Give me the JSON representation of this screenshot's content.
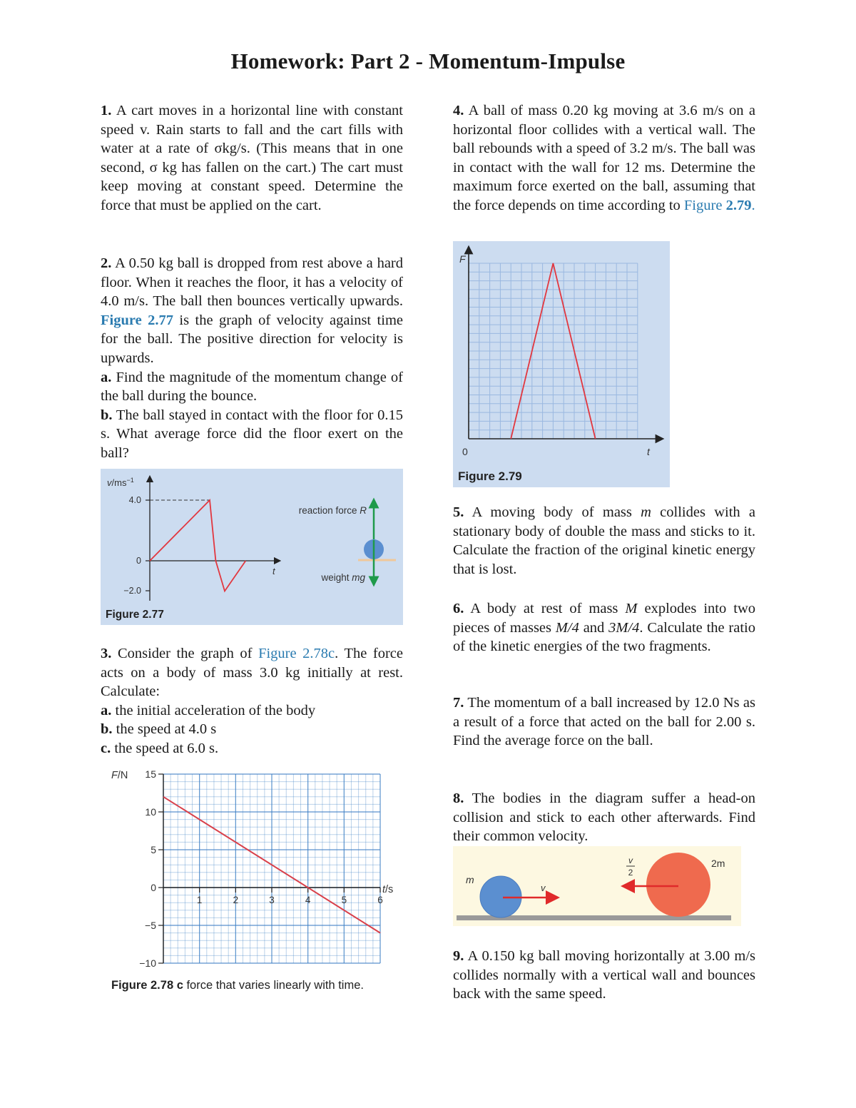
{
  "page": {
    "title": "Homework:  Part 2 - Momentum-Impulse"
  },
  "questions": {
    "q1": {
      "number": "1.",
      "text": "A cart moves in a horizontal line with constant speed v. Rain starts to fall and the cart fills with water at a rate of σkg/s. (This means that in one second, σ kg has fallen on the cart.) The cart must keep moving at constant speed. Determine the force that must be applied on the cart."
    },
    "q2": {
      "number": "2.",
      "text_before_link": "A 0.50 kg ball is dropped from rest above a hard floor. When it reaches the floor, it has a velocity of 4.0 m/s.  The ball then bounces vertically upwards. ",
      "link": "Figure 2.77",
      "text_after_link": " is the graph of velocity against time for the ball. The positive direction for velocity is upwards.",
      "part_a_label": "a.",
      "part_a": "Find the magnitude of the momentum change of the ball during the bounce.",
      "part_b_label": "b.",
      "part_b": "The ball stayed in contact with the floor for 0.15 s. What average force did the floor exert on the ball?"
    },
    "q3": {
      "number": "3.",
      "text_before_link": "Consider the graph of ",
      "link": "Figure 2.78c",
      "text_after_link": ". The force acts on a body of mass 3.0 kg initially at rest. Calculate:",
      "part_a_label": "a.",
      "part_a": "the initial acceleration of the body",
      "part_b_label": "b.",
      "part_b": "the speed at 4.0 s",
      "part_c_label": "c.",
      "part_c": "the speed at 6.0 s."
    },
    "q4": {
      "number": "4.",
      "text_before_link": "A ball of mass 0.20 kg moving at 3.6 m/s on a horizontal floor collides with a vertical wall. The ball rebounds with a speed of 3.2 m/s. The ball was in contact with the wall for 12 ms. Determine the maximum force exerted on the ball, assuming that the force depends on time according to ",
      "link_plain": "Figure ",
      "link_bold": "2.79",
      "text_after_link": "."
    },
    "q5": {
      "number": "5.",
      "text_1": "A moving body of mass ",
      "var_m": "m",
      "text_2": " collides with a stationary body of double the mass and sticks to it. Calculate the fraction of the original kinetic energy that is lost."
    },
    "q6": {
      "number": "6.",
      "text_1": "A body at rest of mass ",
      "var_M": "M",
      "text_2": " explodes into two pieces of masses ",
      "mass1": "M/4",
      "text_3": " and ",
      "mass2": "3M/4",
      "text_4": ". Calculate the ratio of the kinetic energies of the two fragments."
    },
    "q7": {
      "number": "7.",
      "text": "The momentum of a ball increased by 12.0 Ns as a result of a force that acted on the ball for 2.00 s.  Find the average force on the ball."
    },
    "q8": {
      "number": "8.",
      "text": "The bodies in the diagram suffer a head-on collision and stick to each other afterwards. Find their common velocity."
    },
    "q9": {
      "number": "9.",
      "text": "A 0.150 kg ball moving horizontally at 3.00 m/s collides normally with a vertical wall and bounces back with the same speed."
    }
  },
  "figures": {
    "fig277": {
      "caption": "Figure 2.77",
      "reaction_label": "reaction force ",
      "reaction_var": "R",
      "weight_label": "weight ",
      "weight_var": "mg",
      "background": "#ccdcf0",
      "line_color": "#e2373f",
      "arrow_color": "#1e9a4a",
      "ball_color": "#5b8fd0",
      "floor_color": "#f0c89a"
    },
    "fig279": {
      "caption": "Figure 2.79",
      "background": "#ccdcf0",
      "line_color": "#e2373f"
    },
    "fig278c": {
      "caption_bold": "Figure 2.78 ",
      "caption_letter": "c",
      "caption_text": " force that varies linearly with time.",
      "line_color": "#d9404a",
      "grid_color": "#3d7fc4"
    },
    "fig_collision": {
      "small_label": "m",
      "small_velocity": "v",
      "large_label": "2m",
      "large_velocity_num": "v",
      "large_velocity_den": "2",
      "background": "#fdf8e1",
      "small_color": "#5b8fd0",
      "large_color": "#ef6a4e",
      "arrow_color": "#e02a2a",
      "floor_color": "#9a9a9a"
    }
  },
  "chart_data": [
    {
      "id": "fig277",
      "type": "line",
      "title": "Figure 2.77",
      "xlabel": "t",
      "ylabel": "v/ms⁻¹",
      "ytick_labels": [
        "4.0",
        "0",
        "−2.0"
      ],
      "yticks": [
        4.0,
        0,
        -2.0
      ],
      "ylim": [
        -2.5,
        5
      ],
      "x_units": "arbitrary time units (not labelled)",
      "x": [
        0,
        1.0,
        1.1,
        1.25,
        1.6
      ],
      "y": [
        0,
        4.0,
        0,
        -2.0,
        0
      ],
      "reference_lines": [
        {
          "type": "dashed-horizontal",
          "y": 4.0
        }
      ],
      "grid": false
    },
    {
      "id": "fig279",
      "type": "line",
      "title": "Figure 2.79",
      "xlabel": "t",
      "ylabel": "F",
      "origin_label": "0",
      "grid_cells_x": 16,
      "grid_cells_y": 20,
      "x": [
        0,
        4,
        8,
        12,
        16
      ],
      "y": [
        0,
        0,
        20,
        0,
        0
      ],
      "x_units": "grid cells (unlabelled)",
      "y_units": "grid cells (unlabelled)",
      "grid": true
    },
    {
      "id": "fig278c",
      "type": "line",
      "title": "Figure 2.78 c force that varies linearly with time.",
      "xlabel": "t/s",
      "ylabel": "F/N",
      "xticks": [
        1,
        2,
        3,
        4,
        5,
        6
      ],
      "xtick_labels": [
        "1",
        "2",
        "3",
        "4",
        "5",
        "6"
      ],
      "yticks": [
        15,
        10,
        5,
        0,
        -5,
        -10
      ],
      "ytick_labels": [
        "15",
        "10",
        "5",
        "0",
        "−5",
        "−10"
      ],
      "xlim": [
        0,
        6
      ],
      "ylim": [
        -10,
        15
      ],
      "x": [
        0,
        6
      ],
      "y": [
        12,
        -6
      ],
      "grid": true,
      "minor_divisions": 5
    }
  ]
}
